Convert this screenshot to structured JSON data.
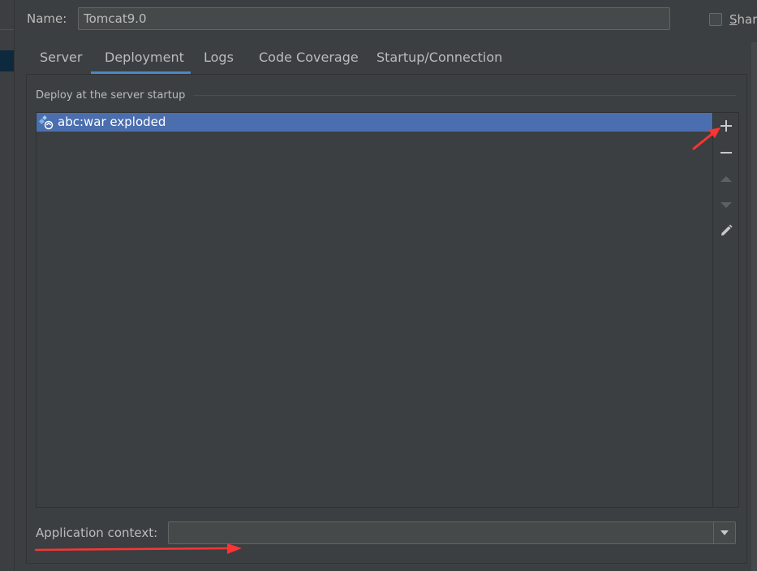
{
  "name_field": {
    "label": "Name:",
    "value": "Tomcat9.0"
  },
  "share": {
    "mnemonic": "S",
    "rest": "hare",
    "checked": false
  },
  "tabs": [
    {
      "label": "Server"
    },
    {
      "label": "Deployment",
      "active": true
    },
    {
      "label": "Logs"
    },
    {
      "label": "Code Coverage"
    },
    {
      "label": "Startup/Connection"
    }
  ],
  "deploy": {
    "section_title": "Deploy at the server startup",
    "artifacts": [
      {
        "label": "abc:war exploded",
        "icon": "artifact-exploded-icon",
        "selected": true
      }
    ],
    "toolbar": [
      "add-icon",
      "remove-icon",
      "move-up-icon",
      "move-down-icon",
      "edit-icon"
    ]
  },
  "application_context": {
    "label": "Application context:",
    "value": ""
  },
  "colors": {
    "background": "#3c3f41",
    "selection": "#4b6eaf",
    "tab_underline": "#4a88c7",
    "annotation_arrow": "#ff3333"
  }
}
